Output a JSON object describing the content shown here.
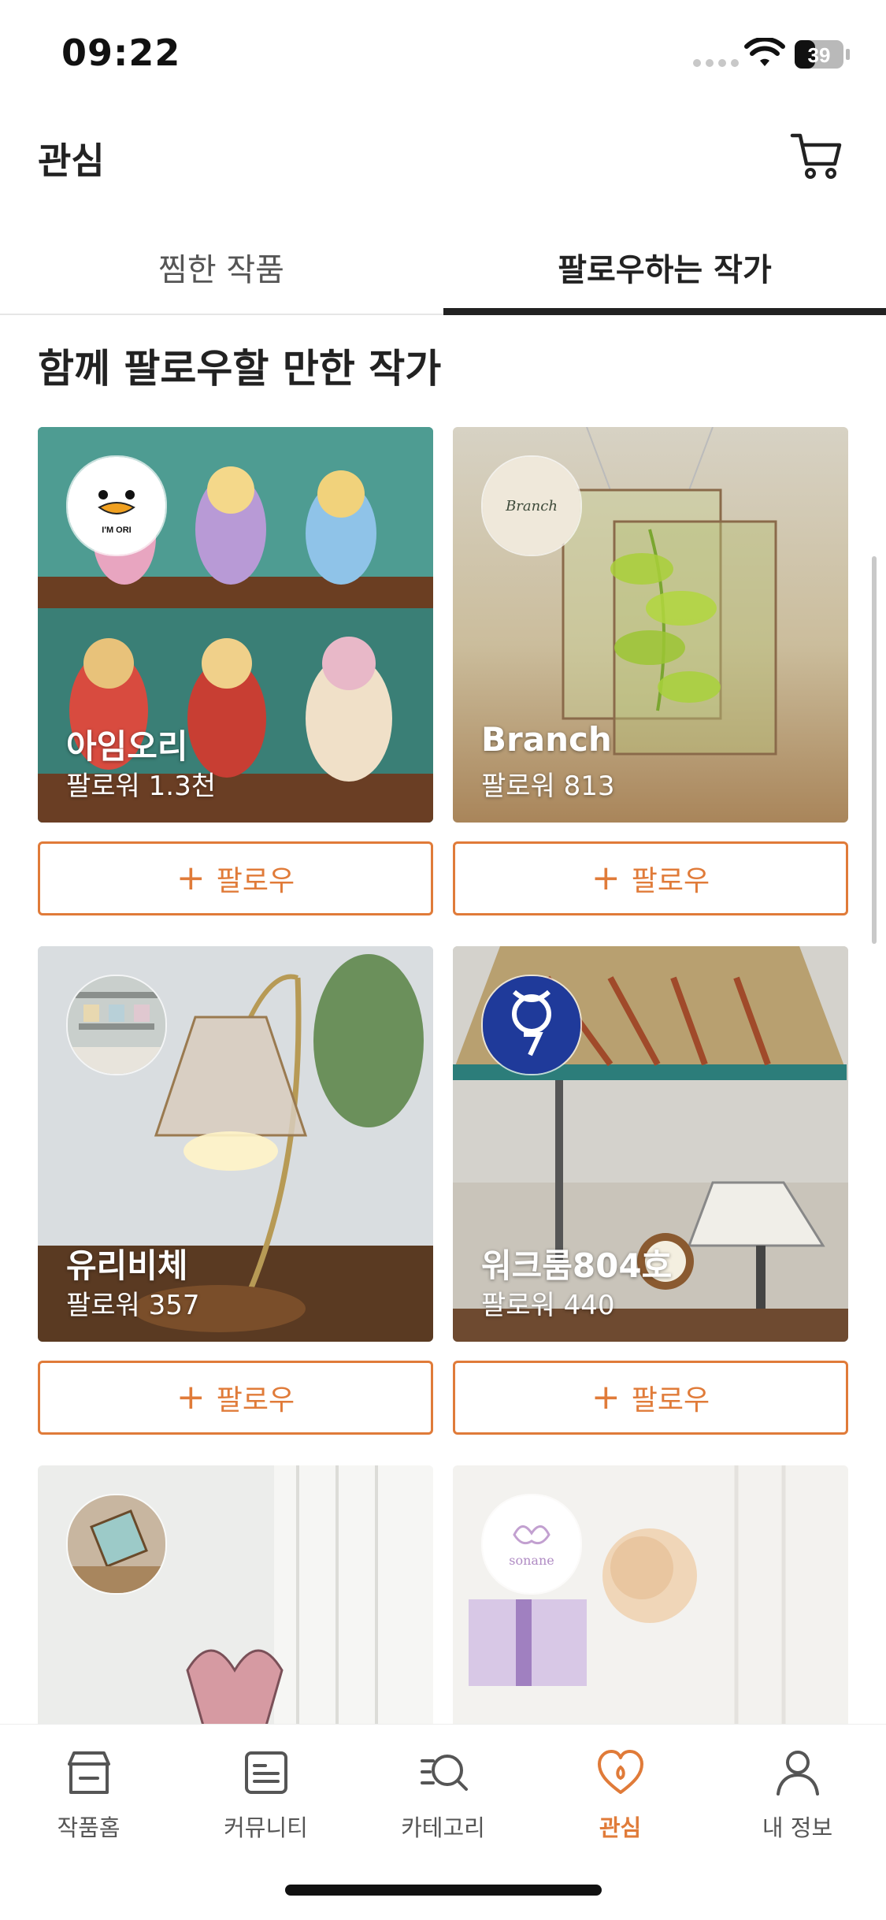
{
  "status_bar": {
    "time": "09:22",
    "battery": "39"
  },
  "header": {
    "title": "관심"
  },
  "tabs": [
    {
      "label": "찜한 작품",
      "active": false
    },
    {
      "label": "팔로우하는 작가",
      "active": true
    }
  ],
  "section_title": "함께 팔로우할 만한 작가",
  "follow_label": "팔로우",
  "artists": [
    {
      "name": "아임오리",
      "followers": "팔로워 1.3천"
    },
    {
      "name": "Branch",
      "followers": "팔로워 813"
    },
    {
      "name": "유리비체",
      "followers": "팔로워 357"
    },
    {
      "name": "워크룸804호",
      "followers": "팔로워 440"
    },
    {
      "name": "",
      "followers": ""
    },
    {
      "name": "",
      "followers": ""
    }
  ],
  "logos": {
    "imori": "I'M ORI",
    "branch": "Branch",
    "sonane": "sonane"
  },
  "tabbar": [
    {
      "label": "작품홈",
      "icon": "store-icon"
    },
    {
      "label": "커뮤니티",
      "icon": "document-icon"
    },
    {
      "label": "카테고리",
      "icon": "category-search-icon"
    },
    {
      "label": "관심",
      "icon": "heart-icon",
      "active": true
    },
    {
      "label": "내 정보",
      "icon": "person-icon"
    }
  ],
  "colors": {
    "accent": "#e07b39",
    "text": "#222222",
    "indicator": "#222222"
  }
}
